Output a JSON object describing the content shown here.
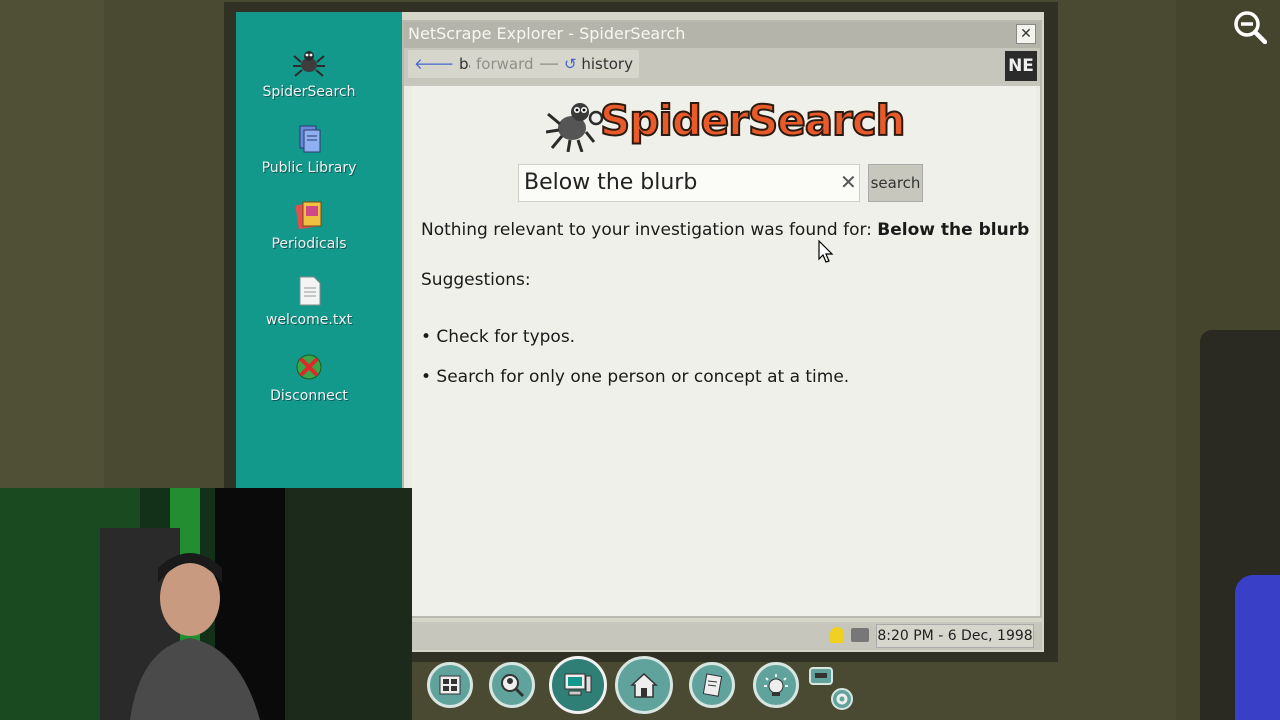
{
  "desktop": {
    "icons": [
      {
        "label": "SpiderSearch",
        "icon": "spider-icon"
      },
      {
        "label": "Public Library",
        "icon": "books-icon"
      },
      {
        "label": "Periodicals",
        "icon": "magazine-icon"
      },
      {
        "label": "welcome.txt",
        "icon": "text-file-icon"
      },
      {
        "label": "Disconnect",
        "icon": "disconnect-icon"
      }
    ]
  },
  "browser": {
    "title": "NetScrape Explorer - SpiderSearch",
    "close_label": "✕",
    "back_label": "back",
    "forward_label": "forward",
    "history_label": "history",
    "brand_badge": "NE"
  },
  "page": {
    "logo_text": "SpiderSearch",
    "search_value": "Below the blurb",
    "clear_label": "✕",
    "search_button": "search",
    "result_prefix": "Nothing relevant to your investigation was found for:",
    "result_query": "Below the blurb",
    "suggestions_heading": "Suggestions:",
    "suggestions": [
      "• Check for typos.",
      "• Search for only one person or concept at a time."
    ]
  },
  "statusbar": {
    "clock": "8:20 PM - 6 Dec, 1998"
  },
  "dock": {
    "items": [
      "evidence-board-icon",
      "search-person-icon",
      "computer-icon",
      "home-icon",
      "notebook-icon",
      "lightbulb-icon",
      "settings-icon"
    ]
  },
  "colors": {
    "desktop": "#13988c",
    "logo_orange": "#e85a2a",
    "dock_teal": "#5fa39c"
  }
}
